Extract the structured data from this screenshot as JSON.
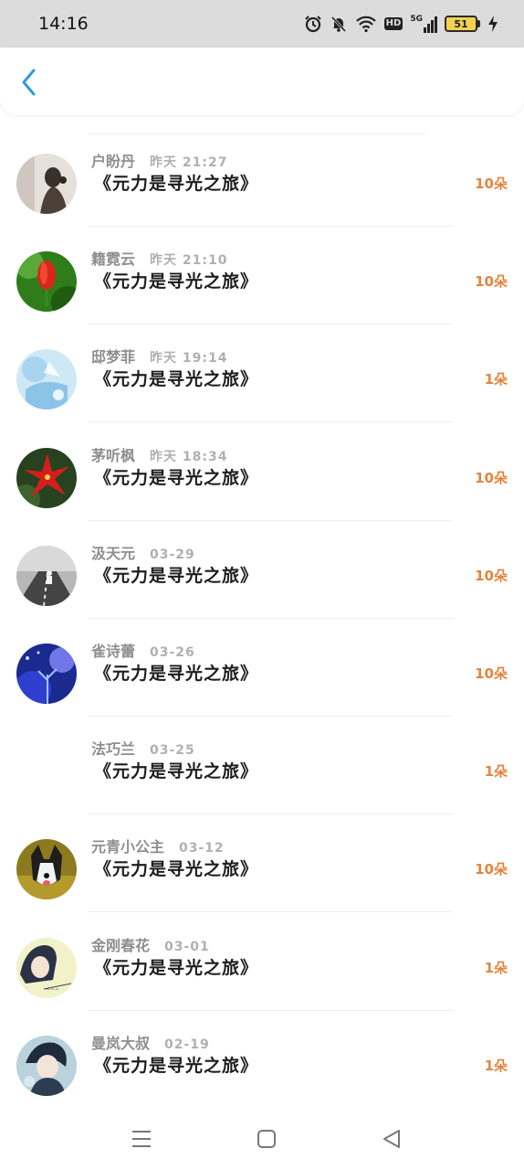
{
  "status_bar": {
    "time": "14:16",
    "network": "5G",
    "hd": "HD",
    "battery": "51"
  },
  "header": {
    "back_icon": "chevron-left-icon",
    "accent": "#2f9bd8"
  },
  "colors": {
    "amount": "#e5843c",
    "name": "#8e8e8e",
    "title": "#1d1d1d"
  },
  "items": [
    {
      "name": "户盼丹",
      "time": "昨天 21:27",
      "title": "《元力是寻光之旅》",
      "amount": "10朵",
      "avatar": "photo-woman"
    },
    {
      "name": "籍霓云",
      "time": "昨天 21:10",
      "title": "《元力是寻光之旅》",
      "amount": "10朵",
      "avatar": "photo-red-tulip"
    },
    {
      "name": "邸梦菲",
      "time": "昨天 19:14",
      "title": "《元力是寻光之旅》",
      "amount": "1朵",
      "avatar": "illustration-blue"
    },
    {
      "name": "茅听枫",
      "time": "昨天 18:34",
      "title": "《元力是寻光之旅》",
      "amount": "10朵",
      "avatar": "photo-red-flower"
    },
    {
      "name": "汲天元",
      "time": "03-29",
      "title": "《元力是寻光之旅》",
      "amount": "10朵",
      "avatar": "photo-road"
    },
    {
      "name": "雀诗蕾",
      "time": "03-26",
      "title": "《元力是寻光之旅》",
      "amount": "10朵",
      "avatar": "photo-blue-night"
    },
    {
      "name": "法巧兰",
      "time": "03-25",
      "title": "《元力是寻光之旅》",
      "amount": "1朵",
      "avatar": "none"
    },
    {
      "name": "元青小公主",
      "time": "03-12",
      "title": "《元力是寻光之旅》",
      "amount": "10朵",
      "avatar": "photo-dog"
    },
    {
      "name": "金刚春花",
      "time": "03-01",
      "title": "《元力是寻光之旅》",
      "amount": "1朵",
      "avatar": "illustration-anime"
    },
    {
      "name": "曼岚大叔",
      "time": "02-19",
      "title": "《元力是寻光之旅》",
      "amount": "1朵",
      "avatar": "illustration-anime-boy"
    }
  ],
  "nav_bar": {
    "menu_icon": "menu-icon",
    "home_icon": "home-square-icon",
    "back_icon": "back-triangle-icon"
  }
}
